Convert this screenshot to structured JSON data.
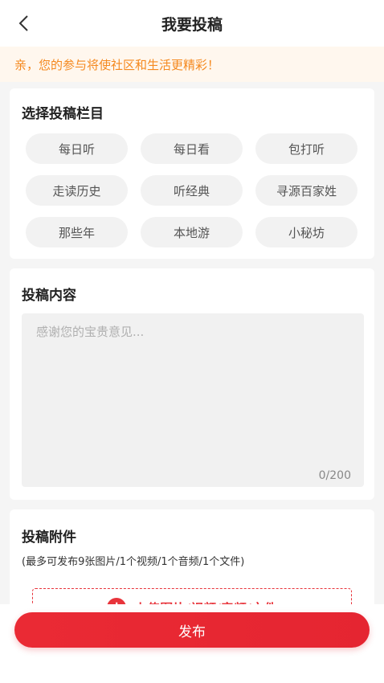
{
  "header": {
    "title": "我要投稿"
  },
  "notice": {
    "text": "亲，您的参与将使社区和生活更精彩！"
  },
  "categories": {
    "title": "选择投稿栏目",
    "items": [
      "每日听",
      "每日看",
      "包打听",
      "走读历史",
      "听经典",
      "寻源百家姓",
      "那些年",
      "本地游",
      "小秘坊"
    ]
  },
  "content": {
    "title": "投稿内容",
    "placeholder": "感谢您的宝贵意见...",
    "counter": "0/200"
  },
  "attachments": {
    "title": "投稿附件",
    "hint": "(最多可发布9张图片/1个视频/1个音频/1个文件)",
    "upload_label": "上传图片/视频/音频/文件",
    "plus": "+"
  },
  "footer": {
    "publish_label": "发布"
  },
  "colors": {
    "accent": "#e8343b",
    "notice_text": "#f5891f",
    "notice_bg": "#fff7ee"
  },
  "icons": {
    "back": "chevron-left-icon",
    "upload": "plus-circle-icon"
  }
}
